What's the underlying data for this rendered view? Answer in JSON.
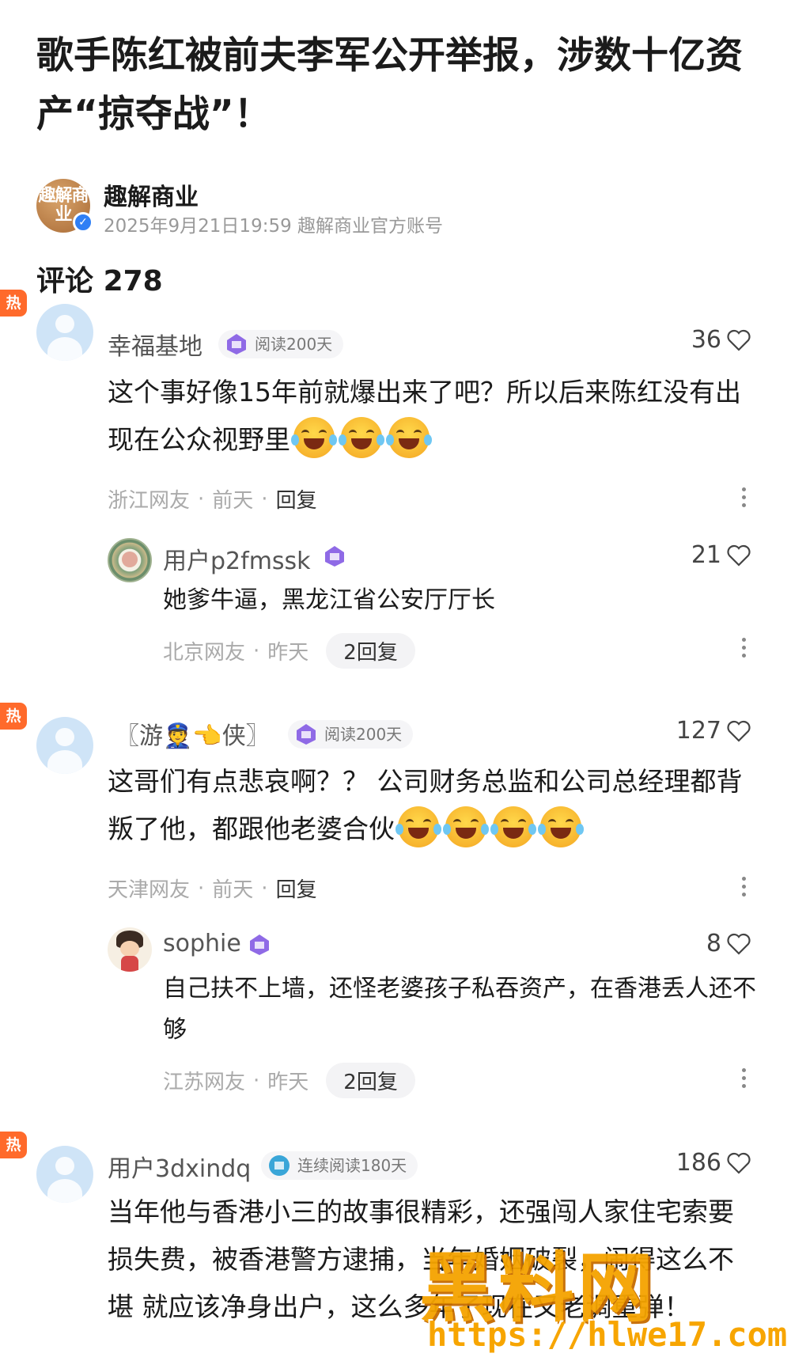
{
  "article": {
    "title": "歌手陈红被前夫李军公开举报，涉数十亿资产“掠夺战”！",
    "author": {
      "avatar_text": "趣解商业",
      "name": "趣解商业",
      "meta": "2025年9月21日19:59 趣解商业官方账号"
    }
  },
  "comments_section": {
    "label": "评论",
    "count": "278"
  },
  "hot_label": "热",
  "comments": [
    {
      "username": "幸福基地",
      "tag": "阅读200天",
      "likes": "36",
      "text": "这个事好像15年前就爆出来了吧？所以后来陈红没有出现在公众视野里",
      "emoji_count": 3,
      "location": "浙江网友",
      "time": "前天",
      "reply_label": "回复",
      "reply": {
        "username": "用户p2fmssk",
        "likes": "21",
        "text": "她爹牛逼，黑龙江省公安厅厅长",
        "location": "北京网友",
        "time": "昨天",
        "reply_count_label": "2回复"
      }
    },
    {
      "username": "〖游👮👈侠〗",
      "tag": "阅读200天",
      "likes": "127",
      "text": "这哥们有点悲哀啊？？ 公司财务总监和公司总经理都背叛了他，都跟他老婆合伙",
      "emoji_count": 4,
      "location": "天津网友",
      "time": "前天",
      "reply_label": "回复",
      "reply": {
        "username": "sophie",
        "likes": "8",
        "text": "自己扶不上墙，还怪老婆孩子私吞资产，在香港丢人还不够",
        "location": "江苏网友",
        "time": "昨天",
        "reply_count_label": "2回复"
      }
    },
    {
      "username": "用户3dxindq",
      "tag": "连续阅读180天",
      "likes": "186",
      "text": "当年他与香港小三的故事很精彩，还强闯人家住宅索要损失费，被香港警方逮捕，当年婚姻破裂，闹得这么不堪 就应该净身出户，这么多年了现在又老调重弹！"
    }
  ],
  "watermark": {
    "logo": "黑料网",
    "url": "https://hlwe17.com"
  },
  "colors": {
    "hot_badge": "#ff6a2b",
    "verified": "#2f7ff5",
    "watermark": "#f5a300"
  }
}
